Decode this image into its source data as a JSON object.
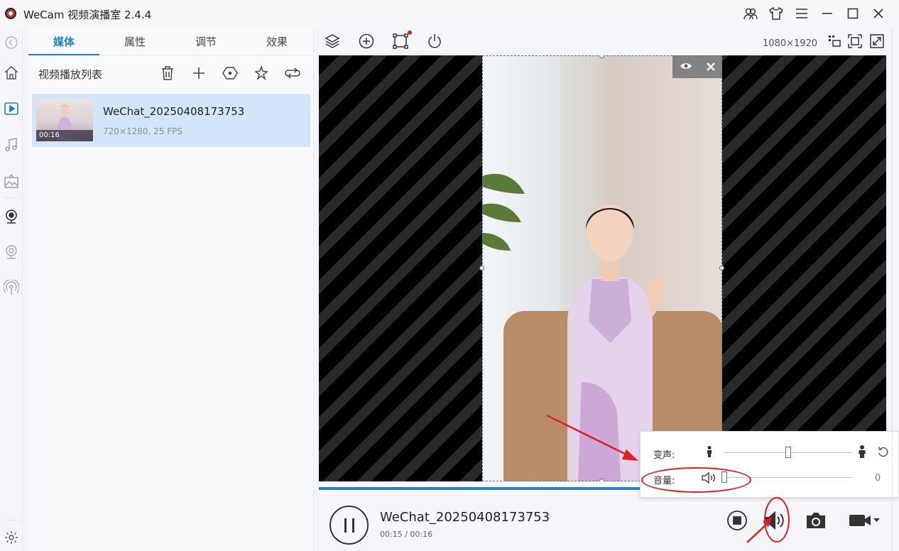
{
  "window": {
    "title": "WeCam 视频演播室 2.4.4"
  },
  "tabs": [
    {
      "label": "媒体",
      "active": true
    },
    {
      "label": "属性",
      "active": false
    },
    {
      "label": "调节",
      "active": false
    },
    {
      "label": "效果",
      "active": false
    }
  ],
  "playlist": {
    "title": "视频播放列表",
    "items": [
      {
        "name": "WeChat_20250408173753",
        "meta": "720×1280, 25 FPS",
        "duration": "00:16",
        "selected": true
      }
    ]
  },
  "preview": {
    "resolution": "1080×1920",
    "progress_fraction": 0.94
  },
  "player": {
    "now_playing": "WeChat_20250408173753",
    "time": "00:15 / 00:16"
  },
  "audio_popup": {
    "voice_label": "变声:",
    "voice_level": 0.5,
    "volume_label": "音量:",
    "volume_value": "0"
  },
  "colors": {
    "accent": "#1f7fd0",
    "selected_row": "#d3e5f8",
    "annotation": "#e41c1c"
  }
}
